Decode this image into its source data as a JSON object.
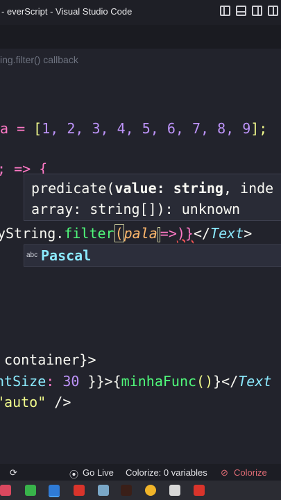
{
  "window": {
    "title": "- everScript - Visual Studio Code"
  },
  "breadcrumb": {
    "text": "ing.filter() callback"
  },
  "code": {
    "l1_op": "a = ",
    "l1_open": "[",
    "l1_items": "1, 2, 3, 4, 5, 6, 7, 8, 9",
    "l1_close": "];",
    "l2_text": "; => {",
    "l3_prefix": "yString.",
    "l3_method": "filter",
    "l3_paren": "(",
    "l3_arg": "pala",
    "l3_arrow": "=>",
    "l3_close": ")}",
    "l3_tag_open": "</",
    "l3_tag": "Text",
    "l3_tag_close": ">",
    "l4_text": " container",
    "l4_close": "}>",
    "l5_prop": "ntSize",
    "l5_colon": ": ",
    "l5_num": "30",
    "l5_rest": " }}>{",
    "l5_func": "minhaFunc",
    "l5_call": "()",
    "l5_end": "}</",
    "l5_tag": "Text",
    "l6_str": "\"auto\"",
    "l6_end": " />"
  },
  "hint": {
    "line1_a": "predicate(",
    "line1_b": "value: string",
    "line1_c": ", inde",
    "line2": "array: string[]): unknown"
  },
  "suggest": {
    "kind": "abc",
    "label": "Pascal"
  },
  "status": {
    "golive": "Go Live",
    "colorize_vars": "Colorize: 0 variables",
    "colorize": "Colorize"
  },
  "colors": {
    "accent": "#bd93f9",
    "background": "#22232c"
  }
}
